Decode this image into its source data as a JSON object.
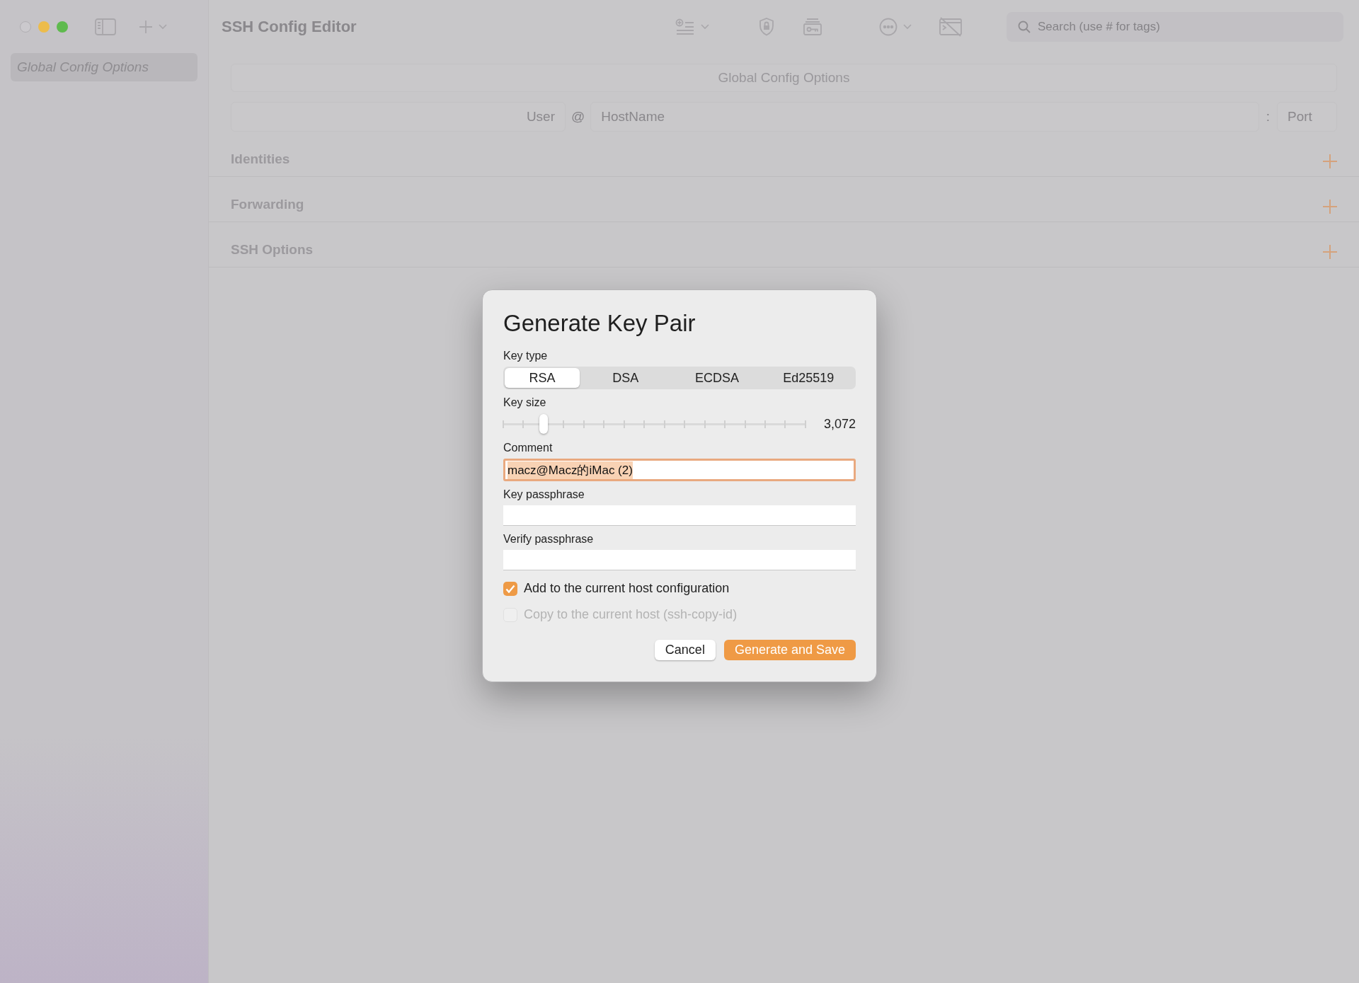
{
  "window": {
    "title": "SSH Config Editor"
  },
  "sidebar": {
    "items": [
      {
        "label": "Global Config Options",
        "selected": true
      }
    ]
  },
  "toolbar": {
    "search": {
      "placeholder": "Search (use # for tags)"
    }
  },
  "editor": {
    "name_field": {
      "value": "Global Config Options"
    },
    "user": {
      "placeholder": "User"
    },
    "at": "@",
    "hostname": {
      "placeholder": "HostName"
    },
    "colon": ":",
    "port": {
      "placeholder": "Port"
    },
    "sections": [
      {
        "label": "Identities"
      },
      {
        "label": "Forwarding"
      },
      {
        "label": "SSH Options"
      }
    ]
  },
  "dialog": {
    "title": "Generate Key Pair",
    "key_type": {
      "label": "Key type",
      "options": [
        {
          "label": "RSA",
          "selected": true
        },
        {
          "label": "DSA",
          "selected": false
        },
        {
          "label": "ECDSA",
          "selected": false
        },
        {
          "label": "Ed25519",
          "selected": false
        }
      ]
    },
    "key_size": {
      "label": "Key size",
      "level": 0.133,
      "reading": "3,072"
    },
    "comment": {
      "label": "Comment",
      "value": "macz@Macz的iMac (2)",
      "text_selected": true
    },
    "key_passphrase": {
      "label": "Key passphrase"
    },
    "verify_passphrase": {
      "label": "Verify passphrase"
    },
    "checkboxes": [
      {
        "label": "Add to the current host configuration",
        "checked": true,
        "disabled": false
      },
      {
        "label": "Copy to the current host (ssh-copy-id)",
        "checked": false,
        "disabled": true
      }
    ],
    "buttons": [
      {
        "label": "Cancel",
        "kind": "secondary"
      },
      {
        "label": "Generate and Save",
        "kind": "primary"
      }
    ]
  }
}
